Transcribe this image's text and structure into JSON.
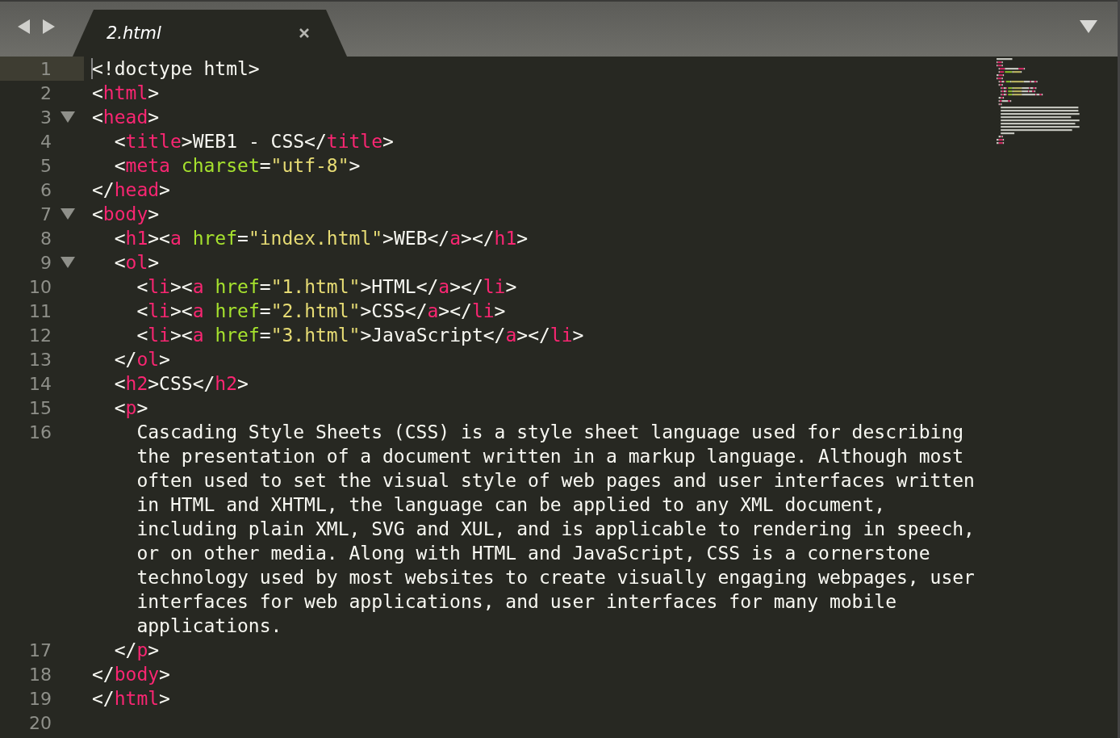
{
  "tab": {
    "title": "2.html"
  },
  "lines": [
    {
      "number": "1",
      "current": true,
      "fold": false,
      "rows": [
        [
          {
            "kind": "plain",
            "text": "<!doctype html>"
          }
        ]
      ]
    },
    {
      "number": "2",
      "current": false,
      "fold": false,
      "rows": [
        [
          {
            "kind": "plain",
            "text": "<"
          },
          {
            "kind": "tag",
            "text": "html"
          },
          {
            "kind": "plain",
            "text": ">"
          }
        ]
      ]
    },
    {
      "number": "3",
      "current": false,
      "fold": true,
      "rows": [
        [
          {
            "kind": "plain",
            "text": "<"
          },
          {
            "kind": "tag",
            "text": "head"
          },
          {
            "kind": "plain",
            "text": ">"
          }
        ]
      ]
    },
    {
      "number": "4",
      "current": false,
      "fold": false,
      "rows": [
        [
          {
            "kind": "plain",
            "text": "  <"
          },
          {
            "kind": "tag",
            "text": "title"
          },
          {
            "kind": "plain",
            "text": ">WEB1 - CSS</"
          },
          {
            "kind": "tag",
            "text": "title"
          },
          {
            "kind": "plain",
            "text": ">"
          }
        ]
      ]
    },
    {
      "number": "5",
      "current": false,
      "fold": false,
      "rows": [
        [
          {
            "kind": "plain",
            "text": "  <"
          },
          {
            "kind": "tag",
            "text": "meta"
          },
          {
            "kind": "plain",
            "text": " "
          },
          {
            "kind": "attr",
            "text": "charset"
          },
          {
            "kind": "plain",
            "text": "="
          },
          {
            "kind": "string",
            "text": "\"utf-8\""
          },
          {
            "kind": "plain",
            "text": ">"
          }
        ]
      ]
    },
    {
      "number": "6",
      "current": false,
      "fold": false,
      "rows": [
        [
          {
            "kind": "plain",
            "text": "</"
          },
          {
            "kind": "tag",
            "text": "head"
          },
          {
            "kind": "plain",
            "text": ">"
          }
        ]
      ]
    },
    {
      "number": "7",
      "current": false,
      "fold": true,
      "rows": [
        [
          {
            "kind": "plain",
            "text": "<"
          },
          {
            "kind": "tag",
            "text": "body"
          },
          {
            "kind": "plain",
            "text": ">"
          }
        ]
      ]
    },
    {
      "number": "8",
      "current": false,
      "fold": false,
      "rows": [
        [
          {
            "kind": "plain",
            "text": "  <"
          },
          {
            "kind": "tag",
            "text": "h1"
          },
          {
            "kind": "plain",
            "text": "><"
          },
          {
            "kind": "tag",
            "text": "a"
          },
          {
            "kind": "plain",
            "text": " "
          },
          {
            "kind": "attr",
            "text": "href"
          },
          {
            "kind": "plain",
            "text": "="
          },
          {
            "kind": "string",
            "text": "\"index.html\""
          },
          {
            "kind": "plain",
            "text": ">WEB</"
          },
          {
            "kind": "tag",
            "text": "a"
          },
          {
            "kind": "plain",
            "text": "></"
          },
          {
            "kind": "tag",
            "text": "h1"
          },
          {
            "kind": "plain",
            "text": ">"
          }
        ]
      ]
    },
    {
      "number": "9",
      "current": false,
      "fold": true,
      "rows": [
        [
          {
            "kind": "plain",
            "text": "  <"
          },
          {
            "kind": "tag",
            "text": "ol"
          },
          {
            "kind": "plain",
            "text": ">"
          }
        ]
      ]
    },
    {
      "number": "10",
      "current": false,
      "fold": false,
      "rows": [
        [
          {
            "kind": "plain",
            "text": "    <"
          },
          {
            "kind": "tag",
            "text": "li"
          },
          {
            "kind": "plain",
            "text": "><"
          },
          {
            "kind": "tag",
            "text": "a"
          },
          {
            "kind": "plain",
            "text": " "
          },
          {
            "kind": "attr",
            "text": "href"
          },
          {
            "kind": "plain",
            "text": "="
          },
          {
            "kind": "string",
            "text": "\"1.html\""
          },
          {
            "kind": "plain",
            "text": ">HTML</"
          },
          {
            "kind": "tag",
            "text": "a"
          },
          {
            "kind": "plain",
            "text": "></"
          },
          {
            "kind": "tag",
            "text": "li"
          },
          {
            "kind": "plain",
            "text": ">"
          }
        ]
      ]
    },
    {
      "number": "11",
      "current": false,
      "fold": false,
      "rows": [
        [
          {
            "kind": "plain",
            "text": "    <"
          },
          {
            "kind": "tag",
            "text": "li"
          },
          {
            "kind": "plain",
            "text": "><"
          },
          {
            "kind": "tag",
            "text": "a"
          },
          {
            "kind": "plain",
            "text": " "
          },
          {
            "kind": "attr",
            "text": "href"
          },
          {
            "kind": "plain",
            "text": "="
          },
          {
            "kind": "string",
            "text": "\"2.html\""
          },
          {
            "kind": "plain",
            "text": ">CSS</"
          },
          {
            "kind": "tag",
            "text": "a"
          },
          {
            "kind": "plain",
            "text": "></"
          },
          {
            "kind": "tag",
            "text": "li"
          },
          {
            "kind": "plain",
            "text": ">"
          }
        ]
      ]
    },
    {
      "number": "12",
      "current": false,
      "fold": false,
      "rows": [
        [
          {
            "kind": "plain",
            "text": "    <"
          },
          {
            "kind": "tag",
            "text": "li"
          },
          {
            "kind": "plain",
            "text": "><"
          },
          {
            "kind": "tag",
            "text": "a"
          },
          {
            "kind": "plain",
            "text": " "
          },
          {
            "kind": "attr",
            "text": "href"
          },
          {
            "kind": "plain",
            "text": "="
          },
          {
            "kind": "string",
            "text": "\"3.html\""
          },
          {
            "kind": "plain",
            "text": ">JavaScript</"
          },
          {
            "kind": "tag",
            "text": "a"
          },
          {
            "kind": "plain",
            "text": "></"
          },
          {
            "kind": "tag",
            "text": "li"
          },
          {
            "kind": "plain",
            "text": ">"
          }
        ]
      ]
    },
    {
      "number": "13",
      "current": false,
      "fold": false,
      "rows": [
        [
          {
            "kind": "plain",
            "text": "  </"
          },
          {
            "kind": "tag",
            "text": "ol"
          },
          {
            "kind": "plain",
            "text": ">"
          }
        ]
      ]
    },
    {
      "number": "14",
      "current": false,
      "fold": false,
      "rows": [
        [
          {
            "kind": "plain",
            "text": "  <"
          },
          {
            "kind": "tag",
            "text": "h2"
          },
          {
            "kind": "plain",
            "text": ">CSS</"
          },
          {
            "kind": "tag",
            "text": "h2"
          },
          {
            "kind": "plain",
            "text": ">"
          }
        ]
      ]
    },
    {
      "number": "15",
      "current": false,
      "fold": false,
      "rows": [
        [
          {
            "kind": "plain",
            "text": "  <"
          },
          {
            "kind": "tag",
            "text": "p"
          },
          {
            "kind": "plain",
            "text": ">"
          }
        ]
      ]
    },
    {
      "number": "16",
      "current": false,
      "fold": false,
      "rows": [
        [
          {
            "kind": "plain",
            "text": "    Cascading Style Sheets (CSS) is a style sheet language used for describing"
          }
        ],
        [
          {
            "kind": "plain",
            "text": "    the presentation of a document written in a markup language. Although most"
          }
        ],
        [
          {
            "kind": "plain",
            "text": "    often used to set the visual style of web pages and user interfaces written"
          }
        ],
        [
          {
            "kind": "plain",
            "text": "    in HTML and XHTML, the language can be applied to any XML document,"
          }
        ],
        [
          {
            "kind": "plain",
            "text": "    including plain XML, SVG and XUL, and is applicable to rendering in speech,"
          }
        ],
        [
          {
            "kind": "plain",
            "text": "    or on other media. Along with HTML and JavaScript, CSS is a cornerstone"
          }
        ],
        [
          {
            "kind": "plain",
            "text": "    technology used by most websites to create visually engaging webpages, user"
          }
        ],
        [
          {
            "kind": "plain",
            "text": "    interfaces for web applications, and user interfaces for many mobile"
          }
        ],
        [
          {
            "kind": "plain",
            "text": "    applications."
          }
        ]
      ]
    },
    {
      "number": "17",
      "current": false,
      "fold": false,
      "rows": [
        [
          {
            "kind": "plain",
            "text": "  </"
          },
          {
            "kind": "tag",
            "text": "p"
          },
          {
            "kind": "plain",
            "text": ">"
          }
        ]
      ]
    },
    {
      "number": "18",
      "current": false,
      "fold": false,
      "rows": [
        [
          {
            "kind": "plain",
            "text": "</"
          },
          {
            "kind": "tag",
            "text": "body"
          },
          {
            "kind": "plain",
            "text": ">"
          }
        ]
      ]
    },
    {
      "number": "19",
      "current": false,
      "fold": false,
      "rows": [
        [
          {
            "kind": "plain",
            "text": "</"
          },
          {
            "kind": "tag",
            "text": "html"
          },
          {
            "kind": "plain",
            "text": ">"
          }
        ]
      ]
    },
    {
      "number": "20",
      "current": false,
      "fold": false,
      "rows": [
        []
      ]
    }
  ]
}
